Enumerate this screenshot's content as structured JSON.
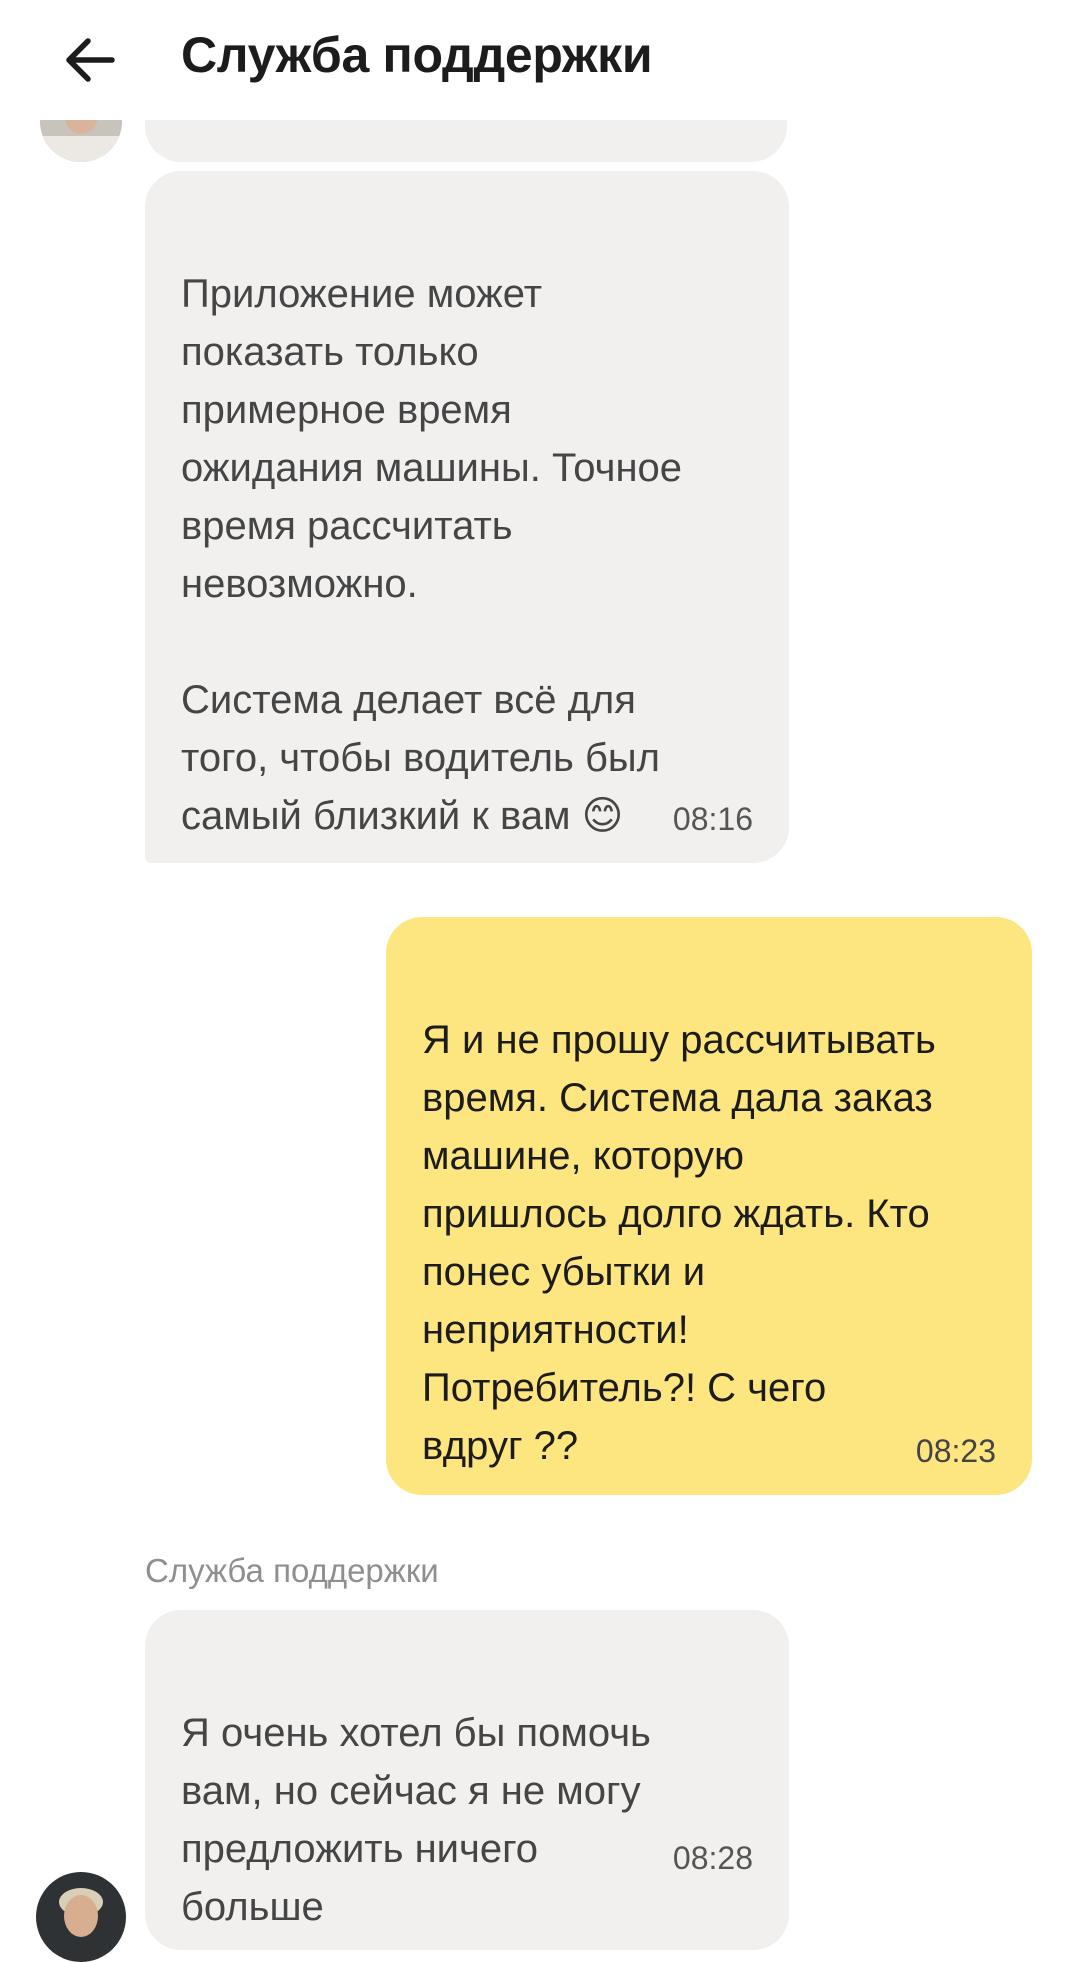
{
  "header": {
    "title": "Служба поддержки",
    "back_icon": "arrow-left-icon"
  },
  "messages": [
    {
      "direction": "incoming",
      "text": "Приложение может\nпоказать только\nпримерное время\nожидания машины. Точное\nвремя рассчитать\nневозможно.\n\nСистема делает всё для\nтого, чтобы водитель был\nсамый близкий к вам 😊",
      "time": "08:16"
    },
    {
      "direction": "outgoing",
      "text": "Я и не прошу рассчитывать\nвремя. Система дала заказ\nмашине, которую\nпришлось долго ждать. Кто\nпонес убытки и\nнеприятности!\nПотребитель?! С чего\nвдруг ??",
      "time": "08:23"
    },
    {
      "direction": "incoming",
      "sender": "Служба поддержки",
      "text": "Я очень хотел бы помочь\nвам, но сейчас я не могу\nпредложить ничего\nбольше",
      "time": "08:28"
    }
  ],
  "colors": {
    "incoming_bubble": "#f1f0ee",
    "outgoing_bubble": "#fde67f",
    "header_background": "#ffffff"
  }
}
